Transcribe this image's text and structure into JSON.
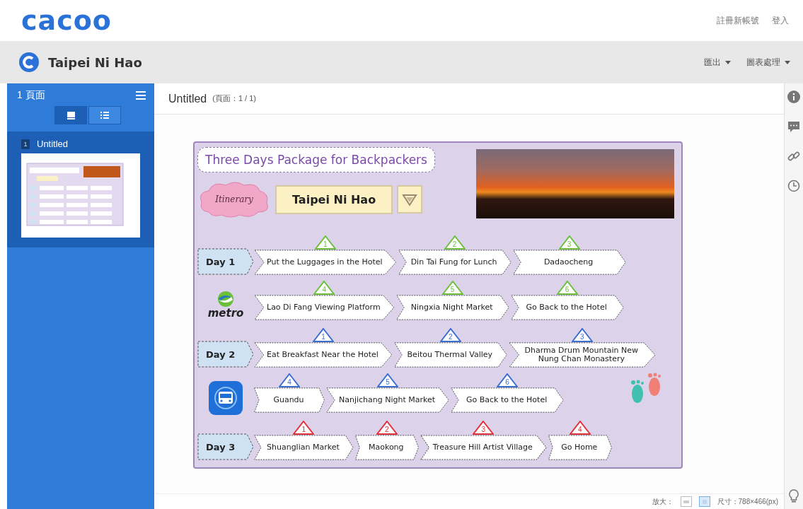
{
  "header": {
    "logo": "cacoo",
    "links": [
      "註冊新帳號",
      "登入"
    ]
  },
  "document": {
    "title": "Taipei Ni Hao",
    "menus": [
      "匯出",
      "圖表處理"
    ]
  },
  "sidebar": {
    "title": "1 頁面",
    "views": [
      {
        "kind": "thumbnails",
        "selected": true
      },
      {
        "kind": "list",
        "selected": false
      }
    ],
    "pages": [
      {
        "number": "1",
        "name": "Untitled",
        "selected": true
      }
    ]
  },
  "page": {
    "title": "Untitled",
    "info": "(頁面：1 / 1)"
  },
  "diagram": {
    "title": "Three Days Package for Backpackers",
    "tag": "Itinerary",
    "name": "Taipei Ni Hao",
    "rows": [
      {
        "kind": "day",
        "label": "Day 1",
        "color": "#6bbf3a",
        "steps": [
          {
            "number": "1",
            "text": "Put the Luggages in the Hotel"
          },
          {
            "number": "2",
            "text": "Din Tai Fung for Lunch"
          },
          {
            "number": "3",
            "text": "Dadaocheng"
          }
        ]
      },
      {
        "kind": "metro",
        "label": "metro",
        "color": "#6bbf3a",
        "steps": [
          {
            "number": "4",
            "text": "Lao Di Fang Viewing Platform"
          },
          {
            "number": "5",
            "text": "Ningxia Night Market"
          },
          {
            "number": "6",
            "text": "Go Back to the Hotel"
          }
        ]
      },
      {
        "kind": "day",
        "label": "Day 2",
        "color": "#3a6fd0",
        "steps": [
          {
            "number": "1",
            "text": "Eat Breakfast Near the Hotel"
          },
          {
            "number": "2",
            "text": "Beitou Thermal Valley"
          },
          {
            "number": "3",
            "text": "Dharma Drum Mountain New Nung Chan Monastery"
          }
        ]
      },
      {
        "kind": "bus",
        "color": "#3a6fd0",
        "steps": [
          {
            "number": "4",
            "text": "Guandu"
          },
          {
            "number": "5",
            "text": "Nanjichang Night Market"
          },
          {
            "number": "6",
            "text": "Go Back to the Hotel"
          }
        ]
      },
      {
        "kind": "day",
        "label": "Day 3",
        "color": "#e0303a",
        "steps": [
          {
            "number": "1",
            "text": "Shuanglian Market"
          },
          {
            "number": "2",
            "text": "Maokong"
          },
          {
            "number": "3",
            "text": "Treasure Hill Artist Village"
          },
          {
            "number": "4",
            "text": "Go Home"
          }
        ]
      }
    ]
  },
  "status_bar": {
    "zoom_label": "放大：",
    "zoom_options": [
      {
        "kind": "fit-width",
        "selected": false
      },
      {
        "kind": "fit-page",
        "selected": true
      }
    ],
    "size": "尺寸：788×466(px)"
  }
}
